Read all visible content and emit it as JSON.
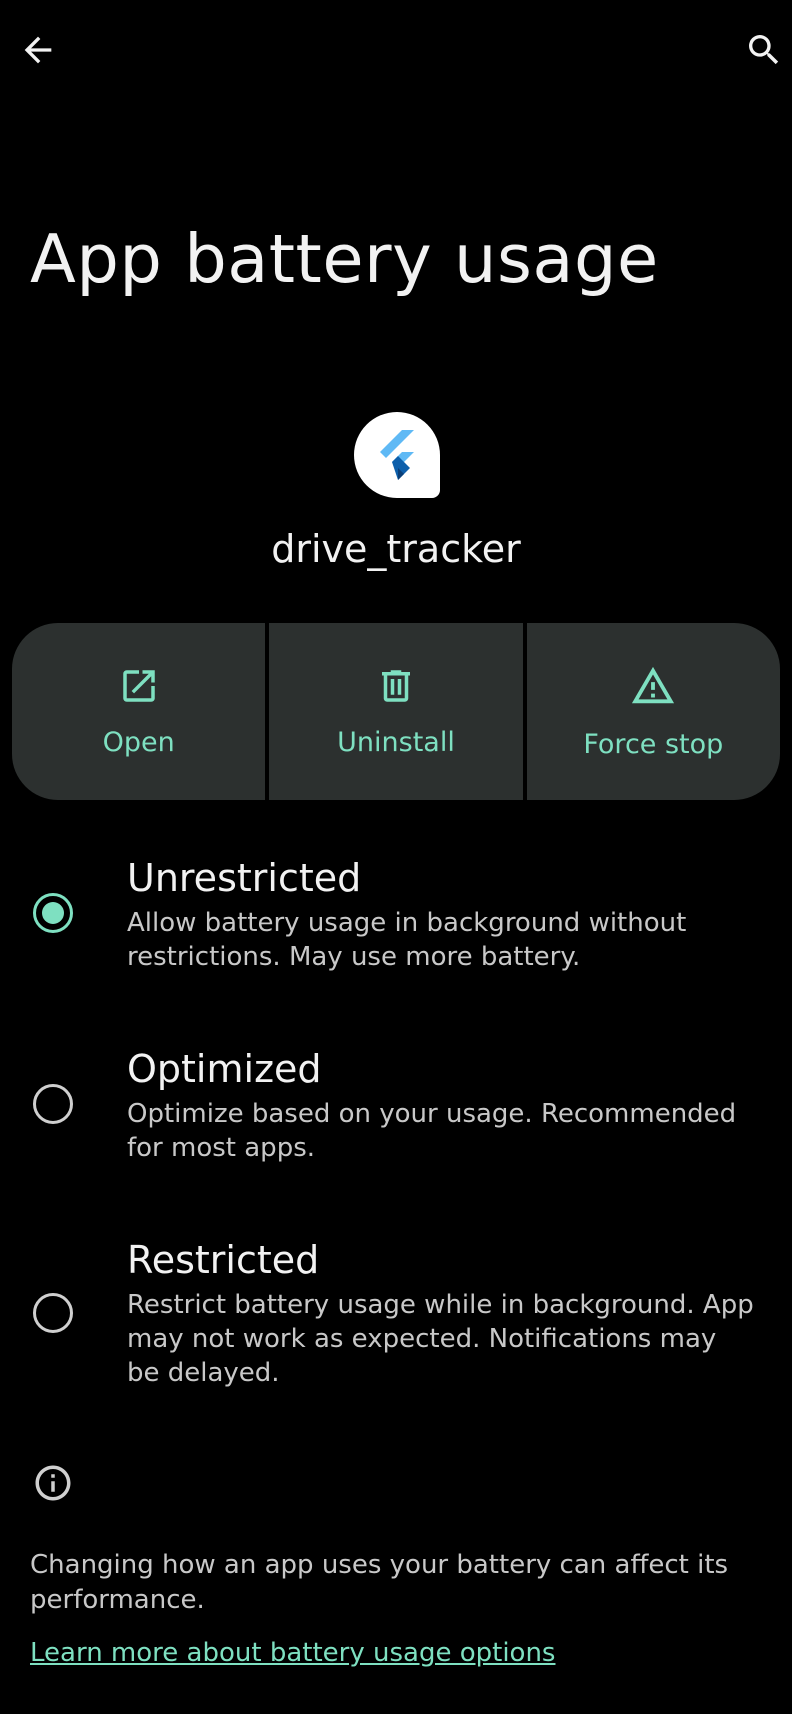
{
  "header": {
    "title": "App battery usage",
    "back_icon": "arrow-back-icon",
    "search_icon": "search-icon"
  },
  "app": {
    "name": "drive_tracker",
    "icon": "flutter-logo-icon"
  },
  "actions": [
    {
      "label": "Open",
      "icon": "open-external-icon"
    },
    {
      "label": "Uninstall",
      "icon": "trash-icon"
    },
    {
      "label": "Force stop",
      "icon": "warning-icon"
    }
  ],
  "options": [
    {
      "title": "Unrestricted",
      "description": "Allow battery usage in background without restrictions. May use more battery.",
      "selected": true
    },
    {
      "title": "Optimized",
      "description": "Optimize based on your usage. Recommended for most apps.",
      "selected": false
    },
    {
      "title": "Restricted",
      "description": "Restrict battery usage while in background. App may not work as expected. Notifications may be delayed.",
      "selected": false
    }
  ],
  "footer": {
    "info_icon": "info-icon",
    "text": "Changing how an app uses your battery can affect its performance.",
    "link": "Learn more about battery usage options"
  },
  "colors": {
    "background": "#000000",
    "accent": "#7ee0c1",
    "button_bg": "#2c302f",
    "text_primary": "#f2f2f2",
    "text_secondary": "#c8c8c8"
  }
}
